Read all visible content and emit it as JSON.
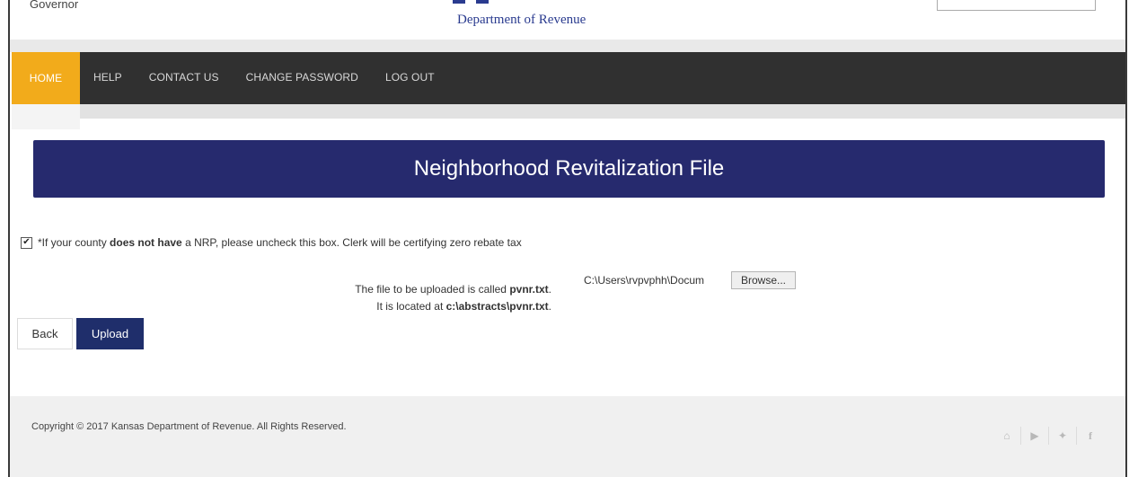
{
  "header": {
    "governor_text": "Governor",
    "department": "Department of Revenue"
  },
  "nav": {
    "items": [
      {
        "label": "HOME",
        "active": true
      },
      {
        "label": "HELP"
      },
      {
        "label": "CONTACT US"
      },
      {
        "label": "CHANGE PASSWORD"
      },
      {
        "label": "LOG OUT"
      }
    ]
  },
  "page": {
    "title": "Neighborhood Revitalization File"
  },
  "nrp": {
    "checked": true,
    "text_before": "*If your county ",
    "text_bold": "does not have",
    "text_after": " a NRP, please uncheck this box. Clerk will be certifying zero rebate tax"
  },
  "file": {
    "line1_prefix": "The file to be uploaded is called ",
    "line1_file": "pvnr.txt",
    "line1_suffix": ".",
    "line2_prefix": "It is located at ",
    "line2_path": "c:\\abstracts\\pvnr.txt",
    "line2_suffix": ".",
    "input_value": "C:\\Users\\rvpvphh\\Docum",
    "browse_label": "Browse..."
  },
  "actions": {
    "back_label": "Back",
    "upload_label": "Upload"
  },
  "footer": {
    "copyright": "Copyright © 2017 Kansas Department of Revenue. All Rights Reserved.",
    "social": [
      "home-icon",
      "youtube-icon",
      "twitter-icon",
      "facebook-icon"
    ]
  },
  "colors": {
    "nav_active": "#f2ab1b",
    "nav_bg": "#303030",
    "banner_bg": "#262a6e",
    "upload_bg": "#1f2e6b"
  }
}
